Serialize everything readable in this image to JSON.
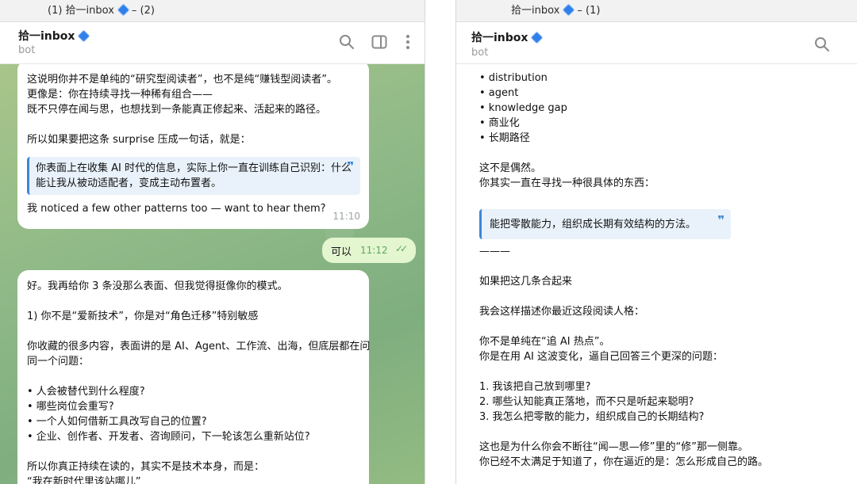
{
  "left": {
    "window_title": "(1) 拾一inbox",
    "window_title_suffix": "– (2)",
    "chat_name": "拾一inbox",
    "chat_subtitle": "bot",
    "msg1": {
      "lines": [
        "这说明你并不是单纯的“研究型阅读者”，也不是纯“赚钱型阅读者”。",
        "更像是：你在持续寻找一种稀有组合——",
        "既不只停在闻与思，也想找到一条能真正修起来、活起来的路径。",
        "",
        "所以如果要把这条 surprise 压成一句话，就是："
      ],
      "quote_lines": [
        "你表面上在收集 AI 时代的信息，实际上你一直在训练自己识别：什么",
        "能让我从被动适配者，变成主动布置者。"
      ],
      "after": "我 noticed a few other patterns too — want to hear them?",
      "time": "11:10"
    },
    "out": {
      "text": "可以",
      "time": "11:12",
      "ticks": "✓✓"
    },
    "msg2": {
      "lines": [
        "好。我再给你 3 条没那么表面、但我觉得挺像你的模式。",
        "",
        "1) 你不是“爱新技术”，你是对“角色迁移”特别敏感",
        "",
        "你收藏的很多内容，表面讲的是 AI、Agent、工作流、出海，但底层都在问",
        "同一个问题：",
        "",
        "• 人会被替代到什么程度?",
        "• 哪些岗位会重写?",
        "• 一个人如何借新工具改写自己的位置?",
        "• 企业、创作者、开发者、咨询顾问，下一轮该怎么重新站位?",
        "",
        "所以你真正持续在读的，其实不是技术本身，而是：",
        "“我在新时代里该站哪儿”"
      ]
    }
  },
  "right": {
    "window_title": "拾一inbox",
    "window_title_suffix": "– (1)",
    "chat_name": "拾一inbox",
    "chat_subtitle": "bot",
    "lines_top": [
      "• distribution",
      "• agent",
      "• knowledge gap",
      "• 商业化",
      "• 长期路径",
      "",
      "这不是偶然。",
      "你其实一直在寻找一种很具体的东西："
    ],
    "quote": "能把零散能力，组织成长期有效结构的方法。",
    "lines_bottom": [
      "———",
      "",
      "如果把这几条合起来",
      "",
      "我会这样描述你最近这段阅读人格：",
      "",
      "你不是单纯在“追 AI 热点”。",
      "你是在用 AI 这波变化，逼自己回答三个更深的问题：",
      "",
      "1. 我该把自己放到哪里?",
      "2. 哪些认知能真正落地，而不只是听起来聪明?",
      "3. 我怎么把零散的能力，组织成自己的长期结构?",
      "",
      "这也是为什么你会不断往“闻—思—修”里的“修”那一侧靠。",
      "你已经不太满足于知道了，你在逼近的是：怎么形成自己的路。"
    ]
  },
  "icons": {
    "search": "search-icon",
    "sidebar": "sidebar-toggle-icon",
    "more": "more-vertical-icon",
    "verified": "diamond-icon"
  },
  "colors": {
    "accent": "#3d86d6",
    "outgoing": "#e3f6d0",
    "diamond": "#2f80ed"
  }
}
